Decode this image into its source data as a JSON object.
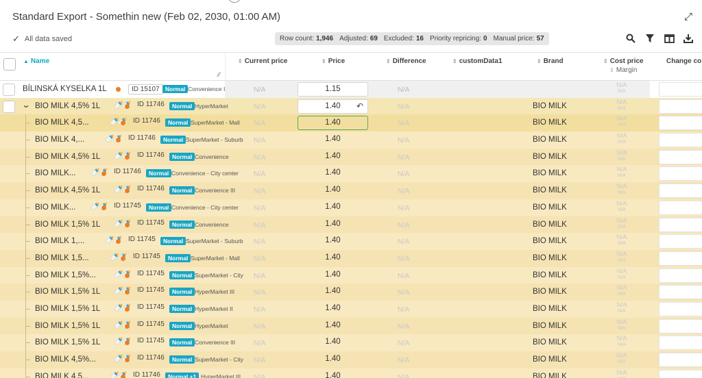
{
  "title": "Standard Export - Somethin new (Feb 02, 2030, 01:00 AM)",
  "saved_status": "All data saved",
  "stats": [
    {
      "label": "Row count:",
      "value": "1,946"
    },
    {
      "label": "Adjusted:",
      "value": "69"
    },
    {
      "label": "Excluded:",
      "value": "16"
    },
    {
      "label": "Priority repricing:",
      "value": "0"
    },
    {
      "label": "Manual price:",
      "value": "57"
    }
  ],
  "toolbar_icons": [
    "search-icon",
    "filter-icon",
    "columns-icon",
    "download-icon"
  ],
  "columns": {
    "name": "Name",
    "current_price": "Current price",
    "price": "Price",
    "difference": "Difference",
    "custom_data1": "customData1",
    "brand": "Brand",
    "cost_price": "Cost price",
    "margin": "Margin",
    "change": "Change co"
  },
  "na": "N/A",
  "rows": [
    {
      "kind": "first",
      "name": "BÍLINSKÁ KYSELKA 1L",
      "bottles": false,
      "id": "ID 15107",
      "badge": "Normal",
      "store": "Convenience III",
      "price": "1.15",
      "brand": ""
    },
    {
      "kind": "parent",
      "name": "BIO MILK 4,5% 1L",
      "bottles": true,
      "id": "ID 11746",
      "badge": "Normal",
      "store": "HyperMarket",
      "price": "1.40",
      "brand": "BIO MILK"
    },
    {
      "kind": "child",
      "name": "BIO MILK 4,5...",
      "bottles": true,
      "id": "ID 11746",
      "badge": "Normal",
      "store": "SuperMarket - Mall",
      "price": "1.40",
      "brand": "BIO MILK"
    },
    {
      "kind": "child",
      "name": "BIO MILK 4,...",
      "bottles": true,
      "id": "ID 11746",
      "badge": "Normal",
      "store": "SuperMarket - Suburb",
      "price": "1.40",
      "brand": "BIO MILK"
    },
    {
      "kind": "child",
      "name": "BIO MILK 4,5% 1L",
      "bottles": true,
      "id": "ID 11746",
      "badge": "Normal",
      "store": "Convenience",
      "price": "1.40",
      "brand": "BIO MILK"
    },
    {
      "kind": "child",
      "name": "BIO MILK...",
      "bottles": true,
      "id": "ID 11746",
      "badge": "Normal",
      "store": "Convenience - City center",
      "price": "1.40",
      "brand": "BIO MILK"
    },
    {
      "kind": "child",
      "name": "BIO MILK 4,5% 1L",
      "bottles": true,
      "id": "ID 11746",
      "badge": "Normal",
      "store": "Convenience III",
      "price": "1.40",
      "brand": "BIO MILK"
    },
    {
      "kind": "child",
      "name": "BIO MILK...",
      "bottles": true,
      "id": "ID 11745",
      "badge": "Normal",
      "store": "Convenience - City center",
      "price": "1.40",
      "brand": "BIO MILK"
    },
    {
      "kind": "child",
      "name": "BIO MILK 1,5% 1L",
      "bottles": true,
      "id": "ID 11745",
      "badge": "Normal",
      "store": "Convenience",
      "price": "1.40",
      "brand": "BIO MILK"
    },
    {
      "kind": "child",
      "name": "BIO MILK 1,...",
      "bottles": true,
      "id": "ID 11745",
      "badge": "Normal",
      "store": "SuperMarket - Suburb",
      "price": "1.40",
      "brand": "BIO MILK"
    },
    {
      "kind": "child",
      "name": "BIO MILK 1,5...",
      "bottles": true,
      "id": "ID 11745",
      "badge": "Normal",
      "store": "SuperMarket - Mall",
      "price": "1.40",
      "brand": "BIO MILK"
    },
    {
      "kind": "child",
      "name": "BIO MILK 1,5%...",
      "bottles": true,
      "id": "ID 11745",
      "badge": "Normal",
      "store": "SuperMarket - City",
      "price": "1.40",
      "brand": "BIO MILK"
    },
    {
      "kind": "child",
      "name": "BIO MILK 1,5% 1L",
      "bottles": true,
      "id": "ID 11745",
      "badge": "Normal",
      "store": "HyperMarket III",
      "price": "1.40",
      "brand": "BIO MILK"
    },
    {
      "kind": "child",
      "name": "BIO MILK 1,5% 1L",
      "bottles": true,
      "id": "ID 11745",
      "badge": "Normal",
      "store": "HyperMarket II",
      "price": "1.40",
      "brand": "BIO MILK"
    },
    {
      "kind": "child",
      "name": "BIO MILK 1,5% 1L",
      "bottles": true,
      "id": "ID 11745",
      "badge": "Normal",
      "store": "HyperMarket",
      "price": "1.40",
      "brand": "BIO MILK"
    },
    {
      "kind": "child",
      "name": "BIO MILK 1,5% 1L",
      "bottles": true,
      "id": "ID 11745",
      "badge": "Normal",
      "store": "Convenience III",
      "price": "1.40",
      "brand": "BIO MILK"
    },
    {
      "kind": "child",
      "name": "BIO MILK 4,5%...",
      "bottles": true,
      "id": "ID 11746",
      "badge": "Normal",
      "store": "SuperMarket - City",
      "price": "1.40",
      "brand": "BIO MILK"
    },
    {
      "kind": "child",
      "name": "BIO MILK 4,5...",
      "bottles": true,
      "id": "ID 11746",
      "badge": "Normal +1",
      "store": "HyperMarket III",
      "price": "1.40",
      "brand": "BIO MILK"
    }
  ]
}
